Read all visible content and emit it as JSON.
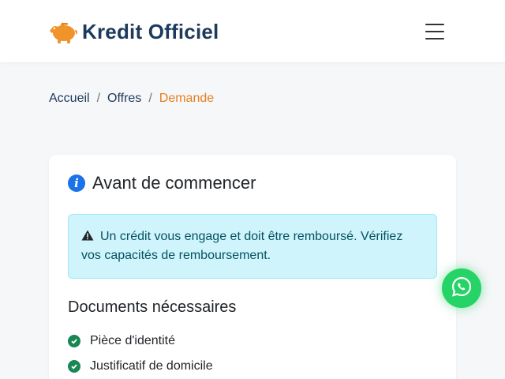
{
  "brand": {
    "name": "Kredit Officiel",
    "icon": "piggy-bank-icon",
    "color": "#1c3a5c",
    "icon_color": "#f0932b"
  },
  "navbar": {
    "toggler_icon": "hamburger-menu-icon"
  },
  "breadcrumb": {
    "items": [
      "Accueil",
      "Offres"
    ],
    "separator": "/",
    "active": "Demande",
    "active_color": "#e67e22"
  },
  "card": {
    "title": "Avant de commencer",
    "title_icon": "info-icon",
    "alert": {
      "icon": "warning-triangle-icon",
      "text": "Un crédit vous engage et doit être remboursé. Vérifiez vos capacités de remboursement.",
      "color": "#cff4fc"
    },
    "documents_title": "Documents nécessaires",
    "documents": [
      "Pièce d'identité",
      "Justificatif de domicile"
    ],
    "check_color": "#198754"
  },
  "whatsapp": {
    "icon": "whatsapp-icon",
    "color": "#25d366"
  }
}
